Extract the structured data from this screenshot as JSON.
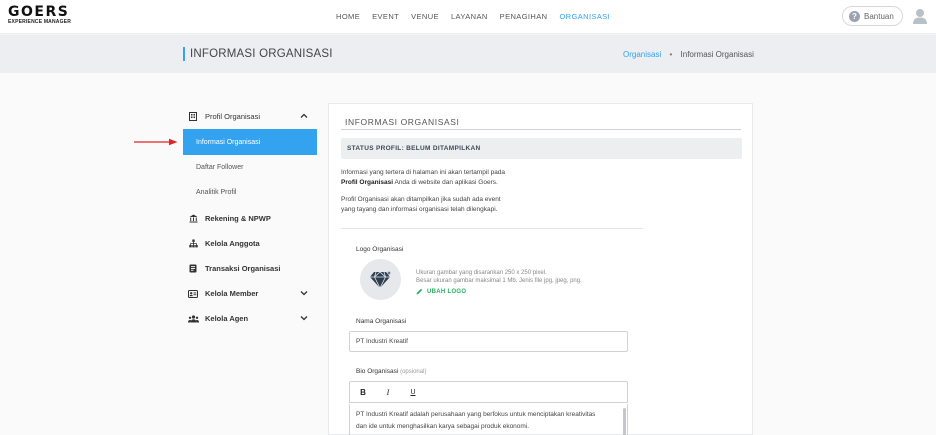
{
  "brand": {
    "logo_main": "GOERS",
    "logo_sub": "EXPERIENCE MANAGER"
  },
  "nav": {
    "items": [
      "HOME",
      "EVENT",
      "VENUE",
      "LAYANAN",
      "PENAGIHAN",
      "ORGANISASI"
    ],
    "active": "ORGANISASI"
  },
  "header_actions": {
    "help_label": "Bantuan",
    "help_icon": "question-circle-icon",
    "user_icon": "user-avatar-icon"
  },
  "page": {
    "title": "INFORMASI ORGANISASI",
    "breadcrumb": {
      "link": "Organisasi",
      "separator": "•",
      "current": "Informasi Organisasi"
    }
  },
  "sidebar": {
    "groups": [
      {
        "label": "Profil Organisasi",
        "icon": "building-icon",
        "expanded": true,
        "children": [
          "Informasi Organisasi",
          "Daftar Follower",
          "Analitik Profil"
        ],
        "active_child": "Informasi Organisasi"
      },
      {
        "label": "Rekening & NPWP",
        "icon": "bank-icon"
      },
      {
        "label": "Kelola Anggota",
        "icon": "org-chart-icon"
      },
      {
        "label": "Transaksi Organisasi",
        "icon": "receipt-icon"
      },
      {
        "label": "Kelola Member",
        "icon": "id-card-icon",
        "expandable": true
      },
      {
        "label": "Kelola Agen",
        "icon": "users-icon",
        "expandable": true
      }
    ]
  },
  "card": {
    "title": "INFORMASI ORGANISASI",
    "status": "STATUS PROFIL: BELUM DITAMPILKAN",
    "info1_line1": "Informasi yang tertera di halaman ini akan tertampil pada",
    "info1_bold": "Profil Organisasi",
    "info1_rest": " Anda di website dan aplikasi Goers.",
    "info2_line1": "Profil Organisasi akan ditampilkan jika sudah ada event",
    "info2_line2": "yang tayang dan informasi organisasi telah dilengkapi.",
    "logo": {
      "label": "Logo Organisasi",
      "hint_line1": "Ukuran gambar yang disarankan 250 x 250 pixel.",
      "hint_line2": "Besar ukuran gambar maksimal 1 Mb. Jenis file jpg, jpeg, png.",
      "change_label": "UBAH LOGO",
      "icon": "diamond-icon"
    },
    "name": {
      "label": "Nama Organisasi",
      "value": "PT Industri Kreatif"
    },
    "bio": {
      "label": "Bio Organisasi",
      "optional": "(opsional)",
      "toolbar": [
        "B",
        "I",
        "U"
      ],
      "line1": "PT Industri Kreatif adalah perusahaan yang berfokus untuk menciptakan kreativitas",
      "line2": "dan ide untuk menghasilkan karya sebagai produk ekonomi."
    }
  },
  "colors": {
    "accent": "#33a3f0",
    "success": "#27ae60",
    "annotation_arrow": "#e02424"
  }
}
